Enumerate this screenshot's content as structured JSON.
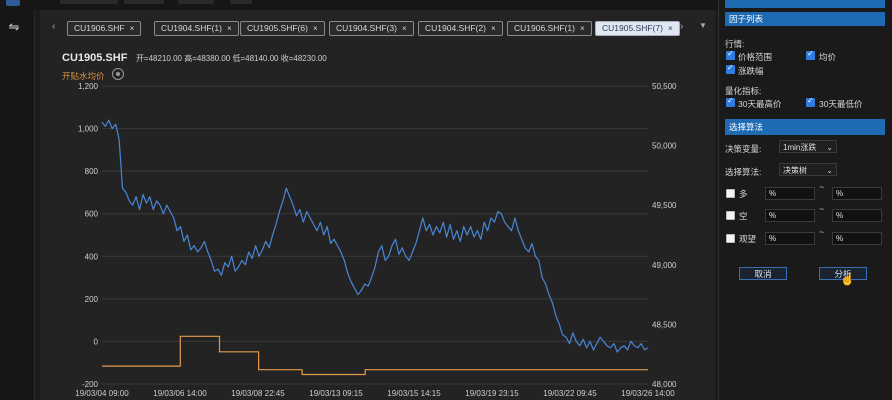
{
  "tabs": {
    "prev_arrow": "‹",
    "next_arrow": "›",
    "menu_arrow": "▼",
    "close_glyph": "×",
    "items": [
      {
        "label": "CU1906.SHF",
        "active": false
      },
      {
        "label": "CU1904.SHF(1)",
        "active": false
      },
      {
        "label": "CU1905.SHF(6)",
        "active": false
      },
      {
        "label": "CU1904.SHF(3)",
        "active": false
      },
      {
        "label": "CU1904.SHF(2)",
        "active": false
      },
      {
        "label": "CU1906.SHF(1)",
        "active": false
      },
      {
        "label": "CU1905.SHF(7)",
        "active": true
      }
    ]
  },
  "chart_header": {
    "symbol": "CU1905.SHF",
    "ohlc": "开=48210.00  高=48380.00  低=48140.00  收=48230.00",
    "indicator": "开贴水均价"
  },
  "chart_data": {
    "type": "line",
    "x_tick_labels": [
      "19/03/04 09:00",
      "19/03/06 14:00",
      "19/03/08 22:45",
      "19/03/13 09:15",
      "19/03/15 14:15",
      "19/03/19 23:15",
      "19/03/22 09:45",
      "19/03/26 14:00"
    ],
    "left_axis": {
      "ticks": [
        "1,200",
        "1,000",
        "800",
        "600",
        "400",
        "200",
        "0",
        "-200"
      ],
      "range": [
        -200,
        1200
      ]
    },
    "right_axis": {
      "ticks": [
        "50,500",
        "50,000",
        "49,500",
        "49,000",
        "48,500",
        "48,000"
      ],
      "range": [
        48000,
        50500
      ]
    },
    "series": [
      {
        "axis": "left",
        "color": "#4a86d6",
        "values": [
          1030,
          1010,
          1040,
          1000,
          1020,
          950,
          720,
          700,
          660,
          640,
          680,
          620,
          690,
          650,
          680,
          620,
          660,
          640,
          600,
          640,
          610,
          580,
          520,
          540,
          470,
          500,
          430,
          450,
          420,
          440,
          470,
          420,
          380,
          330,
          340,
          310,
          370,
          350,
          400,
          330,
          350,
          380,
          360,
          420,
          390,
          450,
          400,
          430,
          470,
          440,
          500,
          550,
          610,
          660,
          720,
          680,
          640,
          590,
          620,
          560,
          610,
          580,
          550,
          520,
          560,
          500,
          540,
          460,
          480,
          450,
          420,
          380,
          320,
          280,
          250,
          220,
          240,
          270,
          260,
          300,
          350,
          420,
          450,
          380,
          400,
          450,
          480,
          410,
          440,
          400,
          380,
          420,
          460,
          520,
          580,
          520,
          550,
          500,
          540,
          510,
          560,
          490,
          550,
          480,
          520,
          470,
          540,
          500,
          540,
          490,
          520,
          480,
          560,
          520,
          580,
          560,
          610,
          600,
          560,
          540,
          520,
          580,
          520,
          480,
          440,
          420,
          460,
          400,
          380,
          300,
          270,
          220,
          180,
          120,
          80,
          30,
          20,
          -10,
          40,
          0,
          -20,
          10,
          -30,
          0,
          -40,
          -10,
          20,
          0,
          -20,
          -30,
          -10,
          -50,
          -30,
          -20,
          -40,
          0,
          -20,
          -30,
          -10,
          -40,
          -30
        ]
      },
      {
        "axis": "right",
        "color": "#e39a4c",
        "values": [
          48150,
          48150,
          48150,
          48150,
          48150,
          48150,
          48150,
          48150,
          48150,
          48150,
          48150,
          48150,
          48150,
          48150,
          48150,
          48150,
          48150,
          48150,
          48150,
          48150,
          48150,
          48150,
          48150,
          48150,
          48150,
          48150,
          48150,
          48150,
          48150,
          48150,
          48150,
          48150,
          48150,
          48150,
          48150,
          48150,
          48400,
          48400,
          48400,
          48400,
          48400,
          48400,
          48400,
          48400,
          48400,
          48400,
          48400,
          48400,
          48400,
          48400,
          48400,
          48400,
          48400,
          48400,
          48270,
          48270,
          48270,
          48270,
          48270,
          48270,
          48270,
          48270,
          48270,
          48270,
          48270,
          48270,
          48270,
          48270,
          48270,
          48270,
          48270,
          48270,
          48120,
          48120,
          48120,
          48120,
          48120,
          48120,
          48120,
          48120,
          48120,
          48120,
          48120,
          48120,
          48120,
          48120,
          48120,
          48120,
          48120,
          48120,
          48120,
          48120,
          48080,
          48080,
          48080,
          48080,
          48080,
          48080,
          48080,
          48080,
          48080,
          48080,
          48080,
          48080,
          48080,
          48080,
          48080,
          48080,
          48080,
          48080,
          48080,
          48080,
          48080,
          48080,
          48080,
          48080,
          48080,
          48080,
          48080,
          48080,
          48080,
          48120,
          48120,
          48120,
          48120,
          48120,
          48120,
          48120,
          48120,
          48120,
          48120,
          48120,
          48120,
          48120,
          48120,
          48120,
          48120,
          48120,
          48120,
          48120,
          48120,
          48120,
          48120,
          48120,
          48120,
          48120,
          48120,
          48120,
          48120,
          48120,
          48120,
          48120,
          48120,
          48120,
          48120,
          48120,
          48120,
          48120,
          48120,
          48120,
          48120,
          48120,
          48120,
          48120,
          48120,
          48120,
          48120,
          48120,
          48120,
          48120,
          48120,
          48120,
          48120,
          48120,
          48120,
          48120,
          48120,
          48120,
          48120,
          48120,
          48120,
          48120,
          48120,
          48120,
          48120,
          48120,
          48120,
          48120,
          48120,
          48120,
          48120,
          48120,
          48120,
          48120,
          48120,
          48120,
          48120,
          48120,
          48120,
          48120,
          48120,
          48120,
          48120,
          48120,
          48120,
          48120,
          48120,
          48120,
          48120,
          48120,
          48120,
          48120,
          48120,
          48120,
          48120,
          48120,
          48120,
          48120,
          48120,
          48120,
          48120,
          48120,
          48120,
          48120,
          48120,
          48120,
          48120,
          48120,
          48120,
          48120,
          48120,
          48120,
          48120,
          48120,
          48120,
          48120,
          48120,
          48120,
          48120,
          48120,
          48120,
          48120,
          48120,
          48120,
          48120,
          48120,
          48120,
          48120,
          48120,
          48120,
          48120,
          48120
        ]
      }
    ]
  },
  "factor_panel": {
    "title": "因子列表",
    "rows_label": "行情:",
    "checks": [
      {
        "label": "价格范围",
        "checked": true
      },
      {
        "label": "均价",
        "checked": true
      },
      {
        "label": "涨跌幅",
        "checked": true
      }
    ],
    "quant_label": "量化指标:",
    "quant_checks": [
      {
        "label": "30天最高价",
        "checked": true
      },
      {
        "label": "30天最低价",
        "checked": true
      }
    ]
  },
  "algo_panel": {
    "title": "选择算法",
    "decision_label": "决策变量:",
    "decision_value": "1min涨跌",
    "algo_label": "选择算法:",
    "algo_value": "决策树",
    "conditions": [
      {
        "label": "多",
        "from": "%",
        "to": "%"
      },
      {
        "label": "空",
        "from": "%",
        "to": "%"
      },
      {
        "label": "观望",
        "from": "%",
        "to": "%"
      }
    ],
    "tilde": "~",
    "cancel_label": "取消",
    "analyze_label": "分析"
  }
}
